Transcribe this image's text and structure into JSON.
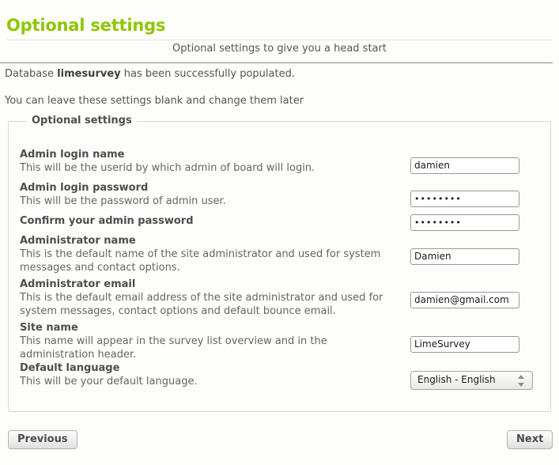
{
  "header": {
    "title": "Optional settings",
    "subtitle": "Optional settings to give you a head start",
    "notice_prefix": "Database ",
    "notice_db": "limesurvey",
    "notice_suffix": " has been successfully populated.",
    "hint": "You can leave these settings blank and change them later"
  },
  "fieldset": {
    "legend": "Optional settings"
  },
  "fields": [
    {
      "label": "Admin login name",
      "description": "This will be the userid by which admin of board will login.",
      "value": "damien",
      "type": "text",
      "name": "admin-login-name"
    },
    {
      "label": "Admin login password",
      "description": "This will be the password of admin user.",
      "value": "••••••••",
      "type": "password",
      "name": "admin-login-password"
    },
    {
      "label": "Confirm your admin password",
      "description": "",
      "value": "••••••••",
      "type": "password",
      "name": "confirm-admin-password"
    },
    {
      "label": "Administrator name",
      "description": "This is the default name of the site administrator and used for system messages and contact options.",
      "value": "Damien",
      "type": "text",
      "name": "administrator-name"
    },
    {
      "label": "Administrator email",
      "description": "This is the default email address of the site administrator and used for system messages, contact options and default bounce email.",
      "value": "damien@gmail.com",
      "type": "text",
      "name": "administrator-email"
    },
    {
      "label": "Site name",
      "description": "This name will appear in the survey list overview and in the administration header.",
      "value": "LimeSurvey",
      "type": "text",
      "name": "site-name"
    },
    {
      "label": "Default language",
      "description": "This will be your default language.",
      "value": "English - English",
      "type": "select",
      "name": "default-language"
    }
  ],
  "footer": {
    "previous_label": "Previous",
    "next_label": "Next"
  },
  "colors": {
    "accent": "#8dc700",
    "text": "#555555",
    "label": "#4d4d4d",
    "background": "#fdfdfb"
  }
}
